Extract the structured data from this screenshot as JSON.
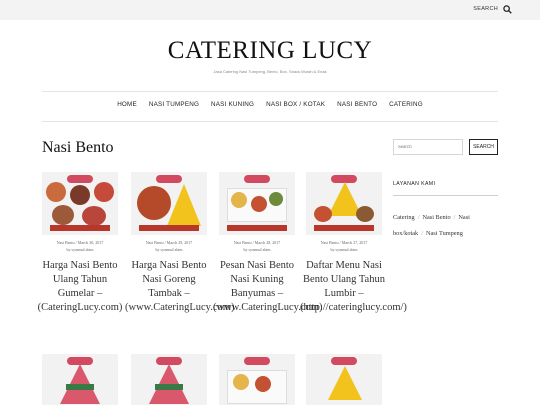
{
  "topbar": {
    "search_label": "SEARCH",
    "search_icon": "search-icon"
  },
  "site": {
    "title": "CATERING LUCY",
    "tagline": "Jasa Catering Nasi Tumpeng, Bento, Box, Snack Murah & Enak"
  },
  "nav": {
    "items": [
      "HOME",
      "NASI TUMPENG",
      "NASI KUNING",
      "NASI BOX / KOTAK",
      "NASI BENTO",
      "CATERING"
    ]
  },
  "archive": {
    "title": "Nasi Bento"
  },
  "posts": [
    {
      "category": "Nasi Bento",
      "date": "March 30, 2017",
      "author": "by syamsul alam",
      "title": "Harga Nasi Bento Ulang Tahun Gumelar – (CateringLucy.com)"
    },
    {
      "category": "Nasi Bento",
      "date": "March 29, 2017",
      "author": "by syamsul alam",
      "title": "Harga Nasi Bento Nasi Goreng Tambak – (www.CateringLucy.com)"
    },
    {
      "category": "Nasi Bento",
      "date": "March 28, 2017",
      "author": "by syamsul alam",
      "title": "Pesan Nasi Bento Nasi Kuning Banyumas – (www.CateringLucy.com)"
    },
    {
      "category": "Nasi Bento",
      "date": "March 27, 2017",
      "author": "by syamsul alam",
      "title": "Daftar Menu Nasi Bento Ulang Tahun Lumbir – (http://cateringlucy.com/)"
    }
  ],
  "sidebar": {
    "search_placeholder": "Search",
    "search_button": "SEARCH",
    "widget_title": "LAYANAN KAMI",
    "categories": [
      "Catering",
      "Nasi Bento",
      "Nasi box/kotak",
      "Nasi Tumpeng"
    ]
  },
  "colors": {
    "badge": "#d24a5f",
    "banner": "#b7372b",
    "tumpeng": "#f2c31d",
    "background": "#ffffff"
  }
}
